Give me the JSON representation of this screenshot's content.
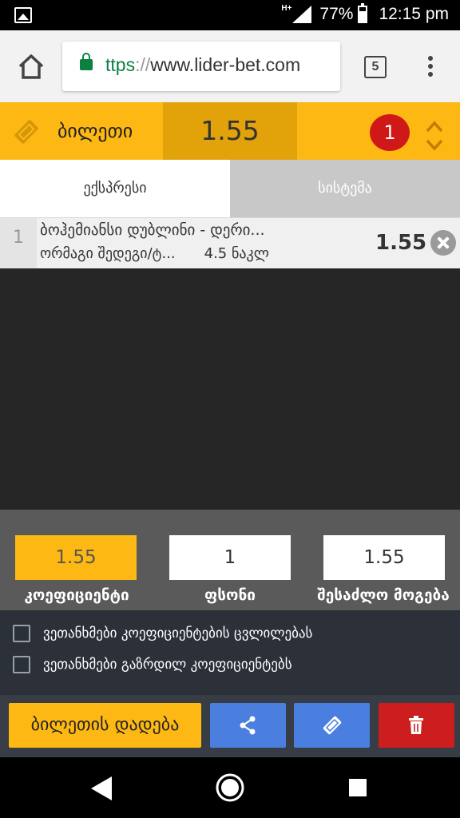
{
  "status_bar": {
    "network": "H+",
    "battery": "77%",
    "time": "12:15 pm"
  },
  "browser": {
    "url_scheme": "ttps",
    "url_sep": "://",
    "url_host": "www.lider-bet.com",
    "tab_count": "5"
  },
  "ticket": {
    "title": "ბილეთი",
    "total_odds": "1.55",
    "count": "1"
  },
  "tabs": {
    "express": "ექსპრესი",
    "system": "სისტემა"
  },
  "bet": {
    "number": "1",
    "event": "ბოჰემიანსი დუბლინი - დერი...",
    "market": "ორმაგი შედეგი/ტ...",
    "handicap": "4.5 ნაკლ",
    "odds": "1.55"
  },
  "summary": {
    "coefficient": "1.55",
    "stake": "1",
    "possible_win": "1.55",
    "coefficient_label": "კოეფიციენტი",
    "stake_label": "ფსონი",
    "possible_win_label": "შესაძლო მოგება"
  },
  "options": {
    "accept_changes": "ვეთანხმები კოეფიციენტების ცვლილებას",
    "accept_increased": "ვეთანხმები გაზრდილ კოეფიციენტებს"
  },
  "actions": {
    "place_bet": "ბილეთის დადება",
    "share_icon": "share-icon",
    "ticket_icon": "ticket-icon",
    "trash_icon": "trash-icon"
  },
  "colors": {
    "accent": "#fdb813",
    "accent_dark": "#e2a30a",
    "badge": "#d01818",
    "action_blue": "#4a7fe0",
    "delete_red": "#cc1e1e"
  }
}
